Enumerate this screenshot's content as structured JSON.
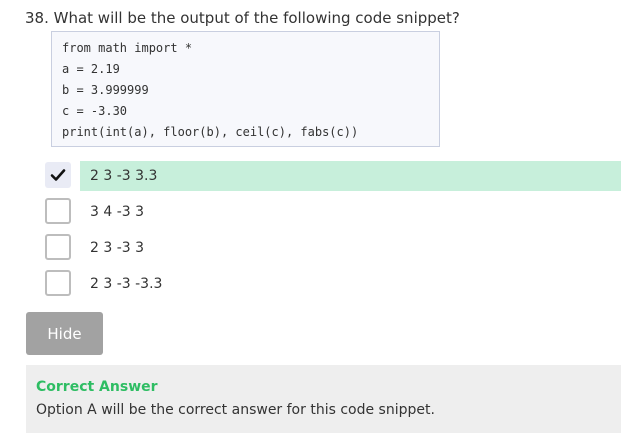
{
  "question": {
    "text": "38. What will be the output of the following code snippet?"
  },
  "code": {
    "lines": [
      "from math import *",
      "a = 2.19",
      "b = 3.999999",
      "c = -3.30",
      "print(int(a), floor(b), ceil(c), fabs(c))"
    ]
  },
  "options": [
    {
      "label": "2 3 -3 3.3",
      "checked": true
    },
    {
      "label": "3 4 -3 3",
      "checked": false
    },
    {
      "label": "2 3 -3 3",
      "checked": false
    },
    {
      "label": "2 3 -3 -3.3",
      "checked": false
    }
  ],
  "hide_button": {
    "label": "Hide"
  },
  "answer": {
    "title": "Correct Answer",
    "text": "Option A will be the correct answer for this code snippet."
  },
  "colors": {
    "correct_highlight": "#c7efdb",
    "answer_title": "#2ebd63",
    "hide_button_bg": "#a2a2a2",
    "code_bg": "#f7f8fc"
  },
  "icons": {
    "checked": "checkmark-icon"
  }
}
